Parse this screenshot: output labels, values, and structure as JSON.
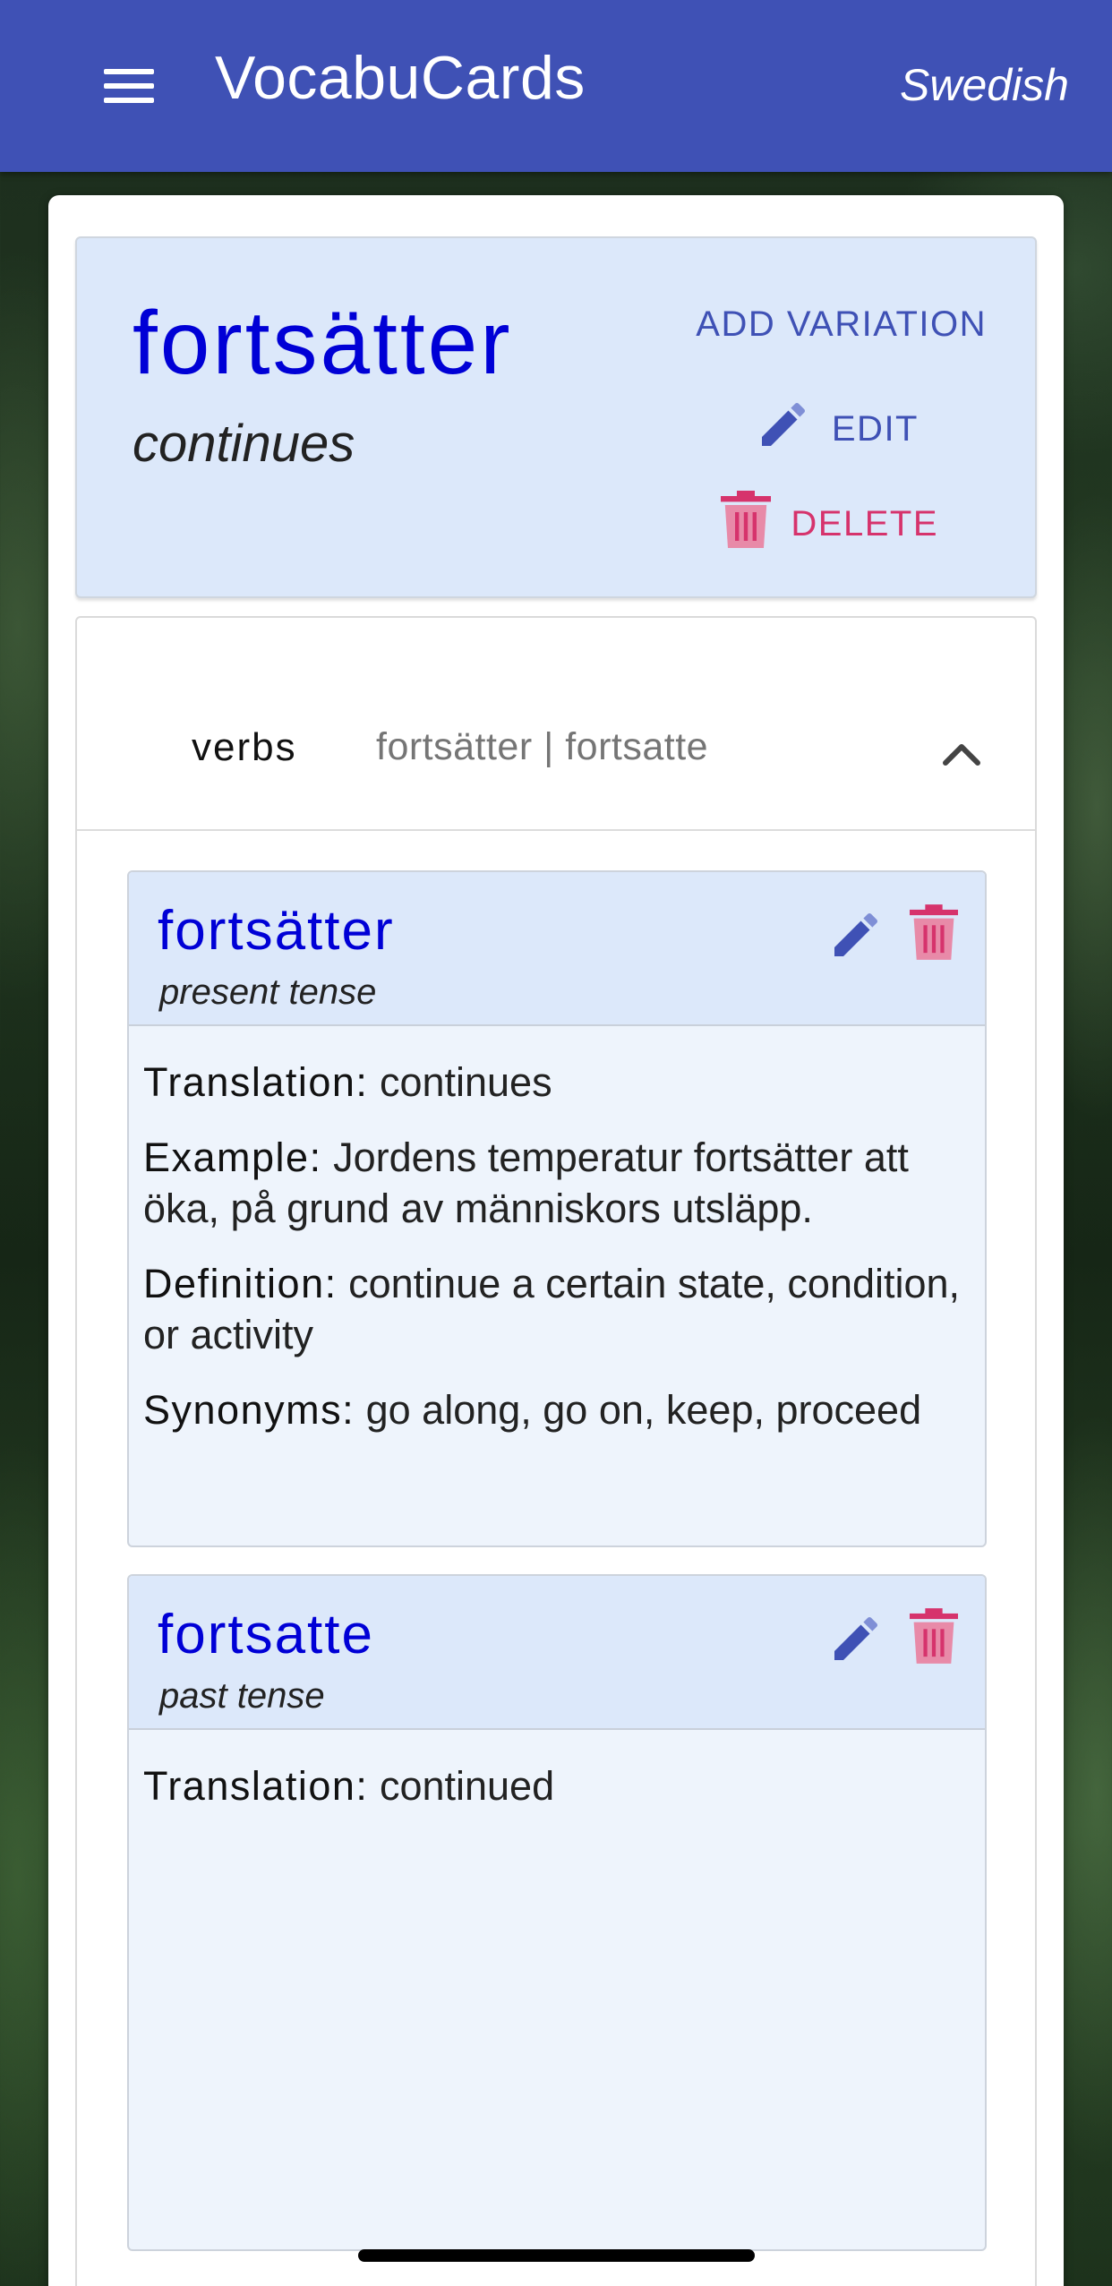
{
  "app_bar": {
    "title": "VocabuCards",
    "language": "Swedish",
    "menu_icon": "hamburger-menu-icon"
  },
  "word": {
    "text": "fortsätter",
    "translation": "continues",
    "actions": {
      "add_variation": "ADD VARIATION",
      "edit": "EDIT",
      "delete": "DELETE"
    }
  },
  "section": {
    "label": "verbs",
    "forms": "fortsätter | fortsatte",
    "expanded": true
  },
  "variations": [
    {
      "word": "fortsätter",
      "tense": "present tense",
      "fields": [
        {
          "label": "Translation:",
          "value": "continues"
        },
        {
          "label": "Example:",
          "value": "Jordens temperatur fortsätter att öka, på grund av människors utsläpp."
        },
        {
          "label": "Definition:",
          "value": "continue a certain state, condition, or activity"
        },
        {
          "label": "Synonyms:",
          "value": "go along, go on, keep, proceed"
        }
      ]
    },
    {
      "word": "fortsatte",
      "tense": "past tense",
      "fields": [
        {
          "label": "Translation:",
          "value": "continued"
        }
      ]
    }
  ],
  "colors": {
    "app_bar": "#3f51b5",
    "word_blue": "#0000d6",
    "delete_red": "#d6336c",
    "card_header": "#dce8fa"
  }
}
